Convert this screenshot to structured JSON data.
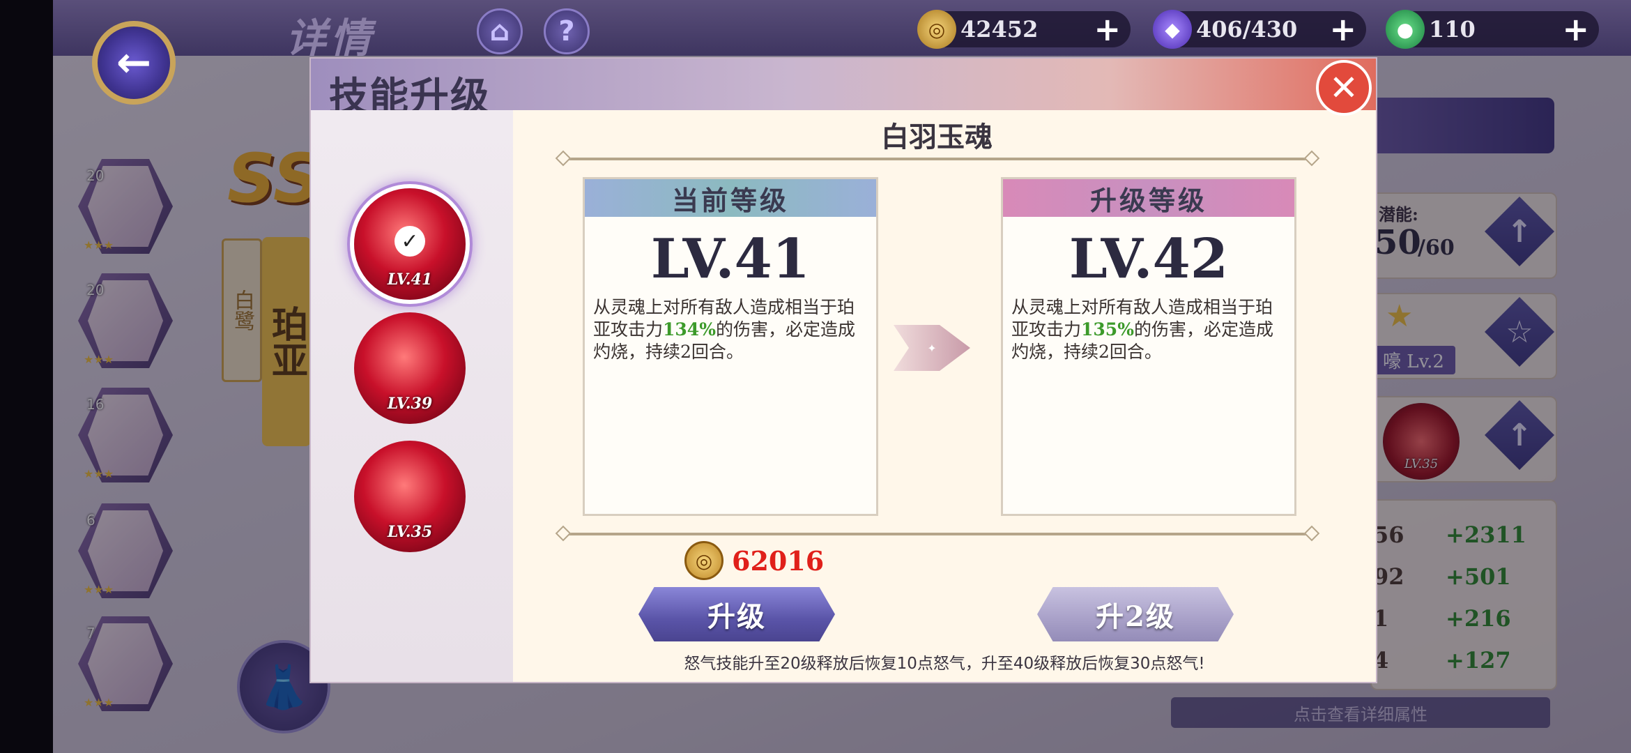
{
  "topbar": {
    "title": "详情",
    "back_icon": "arrow-left-icon",
    "home_icon": "home-icon",
    "help_icon": "question-icon",
    "resources": [
      {
        "icon": "coin-icon",
        "value": "42452",
        "color": "#c08a2a"
      },
      {
        "icon": "stamina-icon",
        "value": "406/430",
        "color": "#6a4ad0"
      },
      {
        "icon": "gem-icon",
        "value": "110",
        "color": "#2aa04a"
      }
    ]
  },
  "equipment": [
    {
      "level": "20",
      "stars": "★★★"
    },
    {
      "level": "20",
      "stars": "★★★"
    },
    {
      "level": "16",
      "stars": "★★★"
    },
    {
      "level": "6",
      "stars": "★★★"
    },
    {
      "level": "7",
      "stars": "★★★"
    }
  ],
  "character": {
    "rarity": "SSR",
    "subname": "白鹭",
    "name": "珀亚"
  },
  "side_panel": {
    "potential_label": "潜能:",
    "potential_value": "50",
    "potential_max": "/60",
    "badge": "嚎  Lv.2",
    "skill_level": "LV.35",
    "stats": [
      {
        "base": "56",
        "add": "+2311"
      },
      {
        "base": "92",
        "add": "+501"
      },
      {
        "base": "1",
        "add": "+216"
      },
      {
        "base": "4",
        "add": "+127"
      }
    ],
    "detail_tip": "点击查看详细属性"
  },
  "modal": {
    "title": "技能升级",
    "skill_name": "白羽玉魂",
    "skills": [
      {
        "level": "LV.41",
        "selected": true
      },
      {
        "level": "LV.39",
        "selected": false
      },
      {
        "level": "LV.35",
        "selected": false
      }
    ],
    "current": {
      "header": "当前等级",
      "level": "LV.41",
      "desc_pre": "从灵魂上对所有敌人造成相当于珀亚攻击力",
      "desc_pct": "134%",
      "desc_post": "的伤害，必定造成灼烧，持续2回合。"
    },
    "upgrade": {
      "header": "升级等级",
      "level": "LV.42",
      "desc_pre": "从灵魂上对所有敌人造成相当于珀亚攻击力",
      "desc_pct": "135%",
      "desc_post": "的伤害，必定造成灼烧，持续2回合。"
    },
    "cost": "62016",
    "btn_upgrade": "升级",
    "btn_upgrade2": "升2级",
    "note": "怒气技能升至20级释放后恢复10点怒气，升至40级释放后恢复30点怒气!"
  },
  "colors": {
    "accent": "#5a54a8",
    "highlight_green": "#3c9a2a",
    "cost_red": "#e0201a",
    "close_red": "#e24a3c"
  }
}
